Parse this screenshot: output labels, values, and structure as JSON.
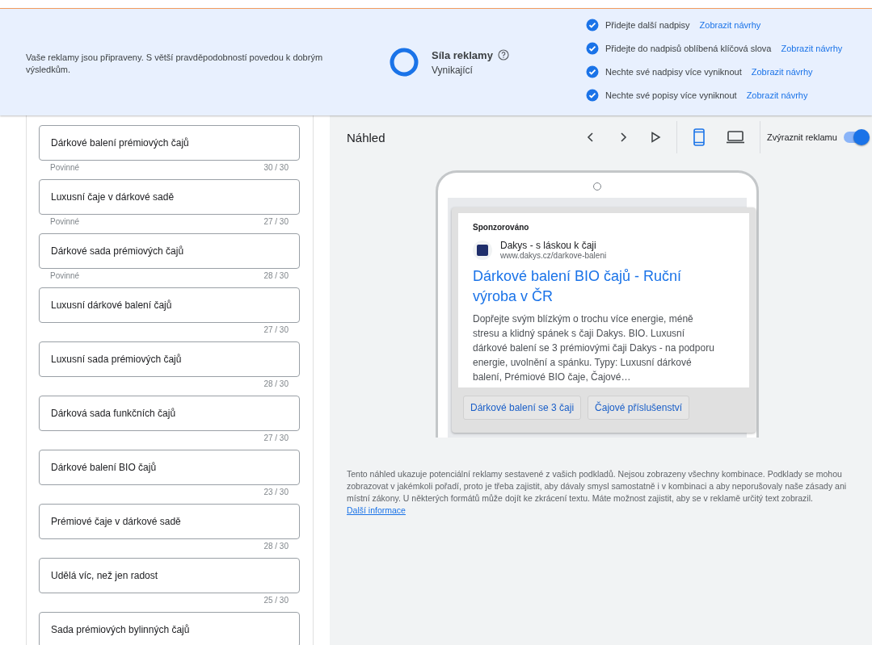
{
  "banner": {
    "message": "Vaše reklamy jsou připraveny. S větší pravděpodobností povedou k dobrým výsledkům.",
    "strength": {
      "title": "Síla reklamy",
      "value": "Vynikající",
      "level": 1
    },
    "tips": [
      {
        "text": "Přidejte další nadpisy",
        "link": "Zobrazit návrhy",
        "checked": true
      },
      {
        "text": "Přidejte do nadpisů oblíbená klíčová slova",
        "link": "Zobrazit návrhy",
        "checked": true
      },
      {
        "text": "Nechte své nadpisy více vyniknout",
        "link": "Zobrazit návrhy",
        "checked": true
      },
      {
        "text": "Nechte své popisy více vyniknout",
        "link": "Zobrazit návrhy",
        "checked": true
      }
    ]
  },
  "headlines": [
    {
      "value": "Dárkové balení prémiových čajů",
      "hint": "Povinné",
      "counter": "30 / 30"
    },
    {
      "value": "Luxusní čaje v dárkové sadě",
      "hint": "Povinné",
      "counter": "27 / 30"
    },
    {
      "value": "Dárkové sada prémiových čajů",
      "hint": "Povinné",
      "counter": "28 / 30"
    },
    {
      "value": "Luxusní dárkové balení čajů",
      "counter": "27 / 30"
    },
    {
      "value": "Luxusní sada prémiových čajů",
      "counter": "28 / 30"
    },
    {
      "value": "Dárková sada funkčních čajů",
      "counter": "27 / 30"
    },
    {
      "value": "Dárkové balení BIO čajů",
      "counter": "23 / 30"
    },
    {
      "value": "Prémiové čaje v dárkové sadě",
      "counter": "28 / 30"
    },
    {
      "value": "Udělá víc, než jen radost",
      "counter": "25 / 30"
    },
    {
      "value": "Sada prémiových bylinných čajů"
    }
  ],
  "preview": {
    "title": "Náhled",
    "devices": [
      {
        "kind": "mobile",
        "selected": true
      },
      {
        "kind": "desktop",
        "selected": false
      }
    ],
    "highlight": {
      "label": "Zvýraznit reklamu",
      "on": true
    },
    "ad": {
      "sponsored": "Sponzorováno",
      "advertiser": "Dakys - s láskou k čaji",
      "url": "www.dakys.cz/darkove-baleni",
      "headline": "Dárkové balení BIO čajů - Ruční výroba v ČR",
      "description": "Dopřejte svým blízkým o trochu více energie, méně stresu a klidný spánek s čaji Dakys. BIO. Luxusní dárkové balení se 3 prémiovými čaji Dakys - na podporu energie, uvolnění a spánku. Typy: Luxusní dárkové balení, Prémiové BIO čaje, Čajové…",
      "sitelinks": [
        "Dárkové balení se 3 čaji",
        "Čajové příslušenství"
      ]
    },
    "note": "Tento náhled ukazuje potenciální reklamy sestavené z vašich podkladů. Nejsou zobrazeny všechny kombinace. Podklady se mohou zobrazovat v jakémkoli pořadí, proto je třeba zajistit, aby dávaly smysl samostatně i v kombinaci a aby neporušovaly naše zásady ani místní zákony. U některých formátů může dojít ke zkrácení textu. Máte možnost zajistit, aby se v reklamě určitý text zobrazil.",
    "note_link": "Další informace"
  }
}
